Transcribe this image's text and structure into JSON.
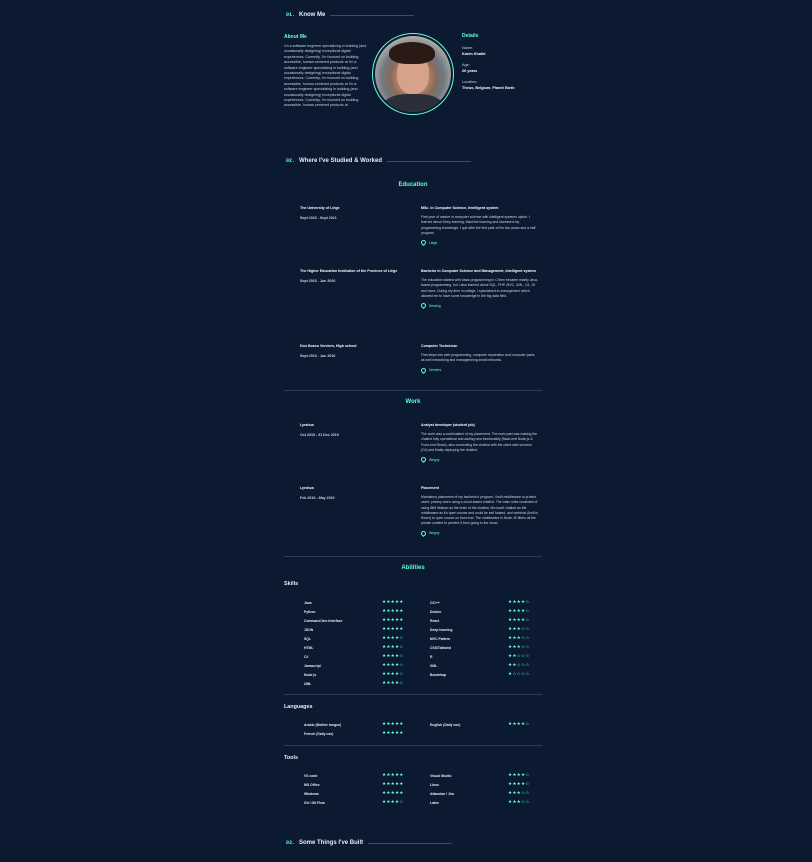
{
  "know_me": {
    "num": "01.",
    "title": "Know Me"
  },
  "about": {
    "heading": "About Me",
    "text": "I'm a software engineer specializing in building (and occasionally designing) exceptional digital experiences. Currently, I'm focused on building accessible, human-centered products at I'm a software engineer specializing in building (and occasionally designing) exceptional digital experiences. Currently, I'm focused on building accessible, human-centered products at I'm a software engineer specializing in building (and occasionally designing) exceptional digital experiences. Currently, I'm focused on building accessible, human-centered products at"
  },
  "details": {
    "heading": "Details",
    "name_label": "Name:",
    "name_value": "Karim Khalid",
    "age_label": "Age:",
    "age_value": "26 years",
    "location_label": "Location:",
    "location_value": "Theux, Belgium, Planet Earth"
  },
  "studied": {
    "num": "02.",
    "title": "Where I've Studied & Worked"
  },
  "education": {
    "heading": "Education",
    "items": [
      {
        "school": "The University of Liège",
        "dates": "Sept 2020 - Sept 2021",
        "degree": "MSc. in Computer Science, Intelligent system",
        "desc": "First year of master in computer science with intelligent systems option. I learned about Deep learning, Machine learning and increased my programming knowledge. I quit after the first year of the two years and a half program.",
        "location": "Liège"
      },
      {
        "school": "The Higher Education Institution of the Province of Liège",
        "dates": "Sept 2016 - Jun 2020",
        "degree": "Bachelor in Computer Science and Management, Intelligent system",
        "desc": "The education started with basic programming in C then became mainly Java-based programming, but I also learned about SQL, PHP, MVC, UML, C#, JS and more. During my time in college, I specialized in management which allowed me to have some knowledge in the big data field.",
        "location": "Seraing"
      },
      {
        "school": "Don Bosco Verviers, High school",
        "dates": "Sept 2010 - Jun 2016",
        "degree": "Computer Technician",
        "desc": "First steps into web programming, computer repairation and computer parts, as well networking and managemning small networks.",
        "location": "Verviers"
      }
    ]
  },
  "work": {
    "heading": "Work",
    "items": [
      {
        "company": "Lyrahus",
        "dates": "Oct 2019 - 31 Dec 2019",
        "role": "Analyst developer (student job)",
        "desc": "The work was a continuation of my placement. The main part was making the chatbot fully operational and adding new functionality (Back-end Node.js & Front-end React), also connecting the chatbot with the client web services (C#) and finally deploying the chatbot.",
        "location": "Wegny"
      },
      {
        "company": "Lyrahus",
        "dates": "Feb 2019 - May 2019",
        "role": "Placement",
        "desc": "Mandatory placement of my bachelor's program. I built middleware to protect users' privacy when using a cloud-based chatbot. The main roles consisted of using IBM Watson as the brain of the chatbot, Microsoft chatbot as the middleware as it's open source and could be self hosted, and webchat (built in React) to open source on front end. The middleware in Node.JS filters all the private content to prevent it from going to the cloud.",
        "location": "Wegny"
      }
    ]
  },
  "abilities": {
    "heading": "Abilities",
    "skills_title": "Skills",
    "skills_left": [
      {
        "name": "Java",
        "rating": 5
      },
      {
        "name": "Python",
        "rating": 5
      },
      {
        "name": "Command line Interface",
        "rating": 5
      },
      {
        "name": "JSON",
        "rating": 5
      },
      {
        "name": "SQL",
        "rating": 4
      },
      {
        "name": "HTML",
        "rating": 4
      },
      {
        "name": "C#",
        "rating": 4
      },
      {
        "name": "Javascript",
        "rating": 4
      },
      {
        "name": "Node js",
        "rating": 4
      },
      {
        "name": "UML",
        "rating": 4
      }
    ],
    "skills_right": [
      {
        "name": "C/C++",
        "rating": 4
      },
      {
        "name": "Docker",
        "rating": 4
      },
      {
        "name": "React",
        "rating": 4
      },
      {
        "name": "Deep learning",
        "rating": 3
      },
      {
        "name": "MVC Pattern",
        "rating": 3
      },
      {
        "name": "CSS/Tailwind",
        "rating": 3
      },
      {
        "name": "R",
        "rating": 2
      },
      {
        "name": "XML",
        "rating": 2
      },
      {
        "name": "Bootstrap",
        "rating": 1
      }
    ],
    "languages_title": "Languages",
    "languages_left": [
      {
        "name": "Arabic (Mother tongue)",
        "rating": 5
      },
      {
        "name": "French (Daily use)",
        "rating": 5
      }
    ],
    "languages_right": [
      {
        "name": "English (Daily use)",
        "rating": 4
      }
    ],
    "tools_title": "Tools",
    "tools_left": [
      {
        "name": "VS code",
        "rating": 5
      },
      {
        "name": "MS Office",
        "rating": 5
      },
      {
        "name": "Windows",
        "rating": 5
      },
      {
        "name": "Git / Git Flow",
        "rating": 4
      }
    ],
    "tools_right": [
      {
        "name": "Visual Studio",
        "rating": 4
      },
      {
        "name": "Linux",
        "rating": 4
      },
      {
        "name": "Atlassian / Jira",
        "rating": 3
      },
      {
        "name": "Latex",
        "rating": 3
      }
    ]
  },
  "built": {
    "num": "03.",
    "title": "Some Things I've Built"
  },
  "colors": {
    "background": "#0b1a30",
    "accent": "#64ffda"
  }
}
